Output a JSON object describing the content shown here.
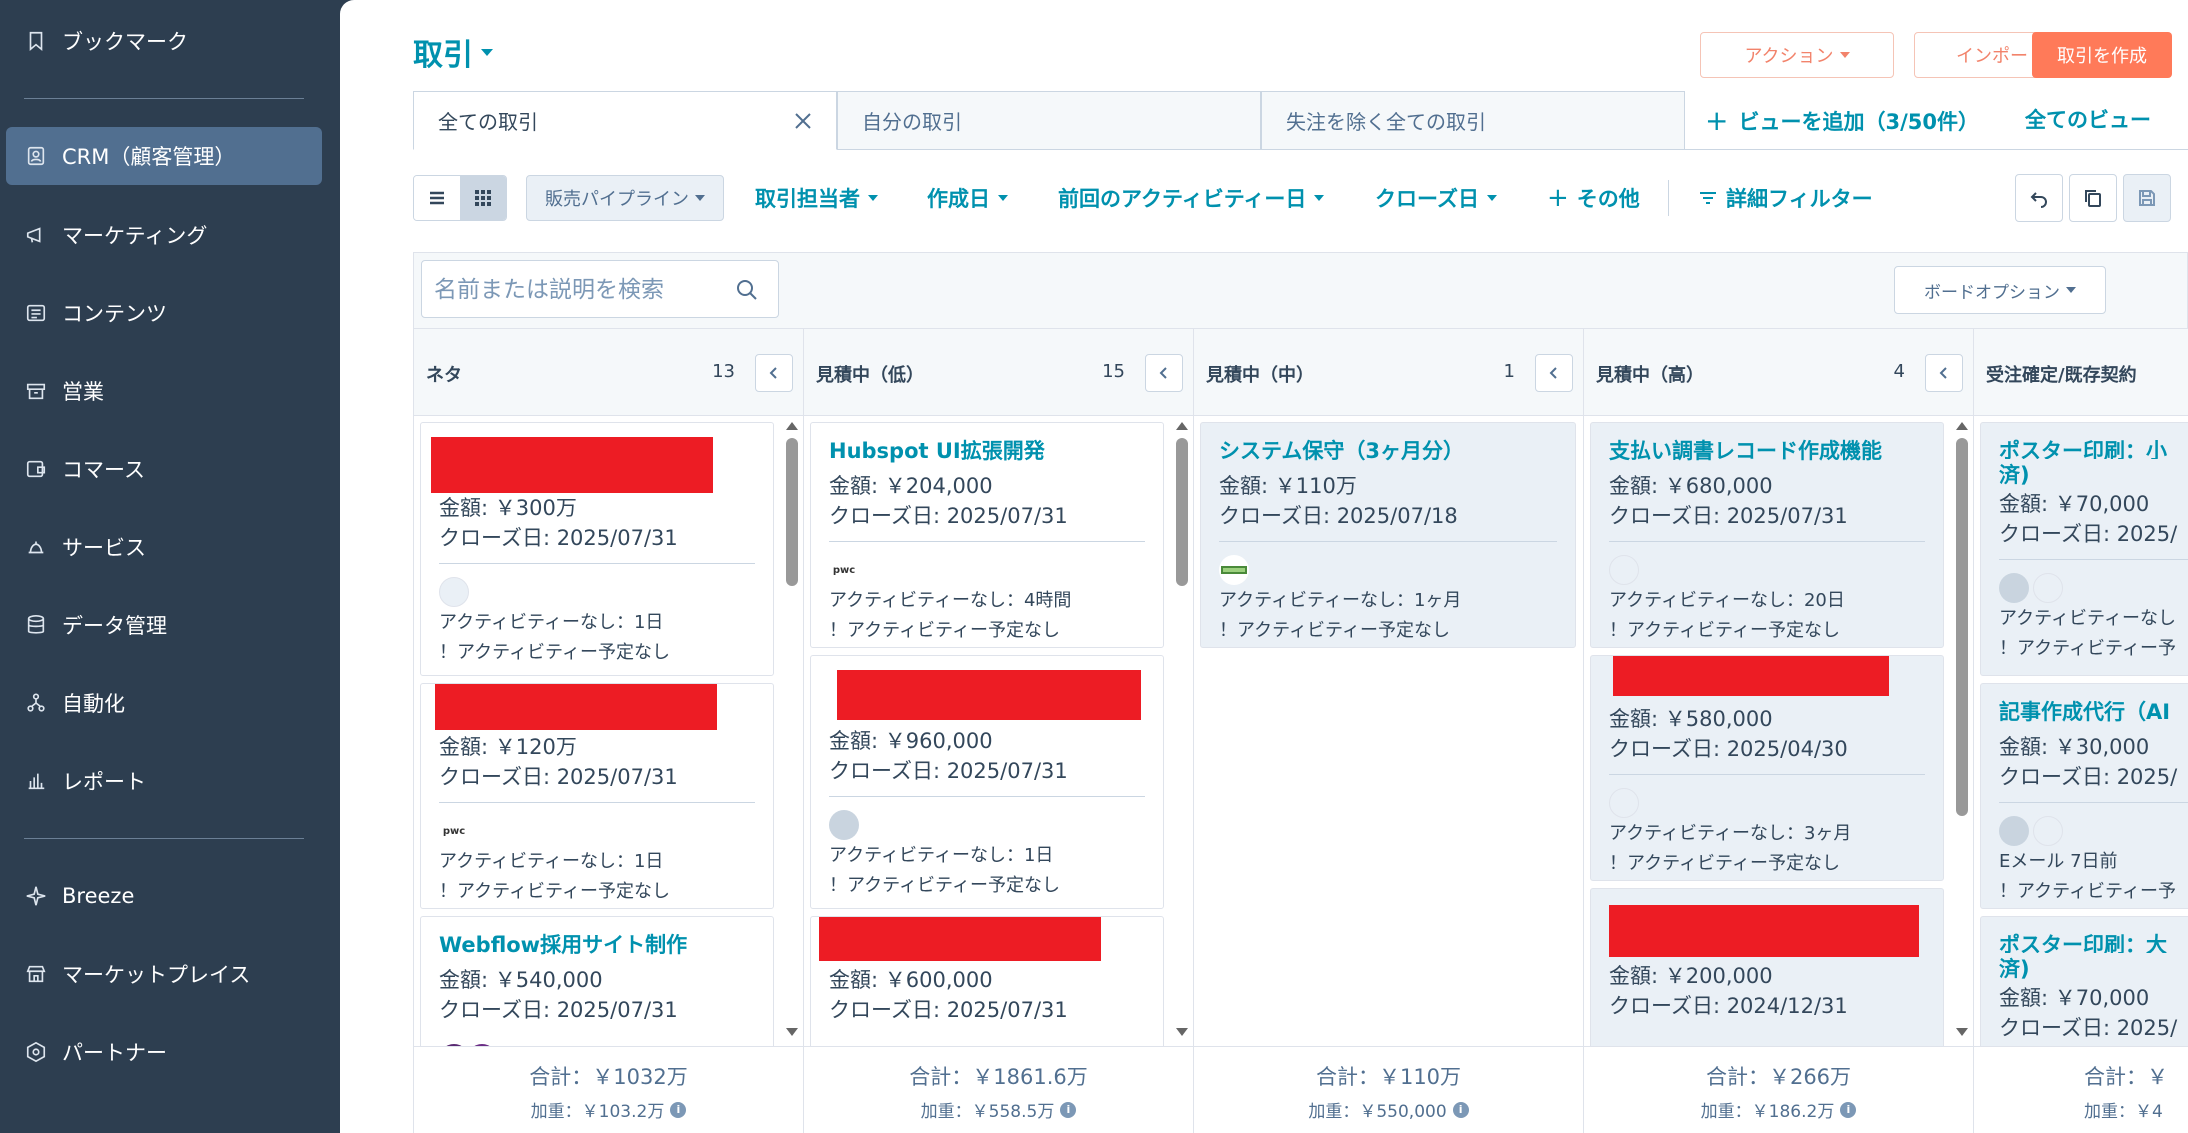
{
  "sidebar": {
    "items": [
      {
        "label": "ブックマーク",
        "icon": "bookmark-icon"
      },
      {
        "label": "CRM（顧客管理）",
        "icon": "contacts-icon",
        "active": true
      },
      {
        "label": "マーケティング",
        "icon": "megaphone-icon"
      },
      {
        "label": "コンテンツ",
        "icon": "content-icon"
      },
      {
        "label": "営業",
        "icon": "sales-icon"
      },
      {
        "label": "コマース",
        "icon": "commerce-icon"
      },
      {
        "label": "サービス",
        "icon": "service-icon"
      },
      {
        "label": "データ管理",
        "icon": "database-icon"
      },
      {
        "label": "自動化",
        "icon": "automation-icon"
      },
      {
        "label": "レポート",
        "icon": "reports-icon"
      },
      {
        "label": "Breeze",
        "icon": "sparkle-icon"
      },
      {
        "label": "マーケットプレイス",
        "icon": "store-icon"
      },
      {
        "label": "パートナー",
        "icon": "partner-icon"
      }
    ]
  },
  "header": {
    "title": "取引",
    "actions_label": "アクション",
    "import_label": "インポート",
    "create_label": "取引を作成"
  },
  "tabs": [
    {
      "label": "全ての取引",
      "active": true
    },
    {
      "label": "自分の取引"
    },
    {
      "label": "失注を除く全ての取引"
    }
  ],
  "add_view_label": "ビューを追加（3/50件）",
  "all_views_label": "全てのビュー",
  "filters": {
    "pipeline": "販売パイプライン",
    "owner": "取引担当者",
    "created": "作成日",
    "last_activity": "前回のアクティビティー日",
    "close_date": "クローズ日",
    "more": "その他",
    "advanced": "詳細フィルター"
  },
  "board": {
    "search_placeholder": "名前または説明を検索",
    "options_label": "ボードオプション",
    "columns": [
      {
        "name": "ネタ",
        "count": "13",
        "total": "合計：￥1032万",
        "weighted": "加重：￥103.2万",
        "cards": [
          {
            "title": "",
            "amount": "金額: ￥300万",
            "close": "クローズ日: 2025/07/31",
            "activity": "アクティビティーなし：1日",
            "next": "！アクティビティー予定なし"
          },
          {
            "title": "",
            "amount": "金額: ￥120万",
            "close": "クローズ日: 2025/07/31",
            "activity": "アクティビティーなし：1日",
            "next": "！アクティビティー予定なし"
          },
          {
            "title": "Webflow採用サイト制作",
            "amount": "金額: ￥540,000",
            "close": "クローズ日: 2025/07/31",
            "activity": "",
            "next": ""
          }
        ]
      },
      {
        "name": "見積中（低）",
        "count": "15",
        "total": "合計：￥1861.6万",
        "weighted": "加重：￥558.5万",
        "cards": [
          {
            "title": "Hubspot UI拡張開発",
            "amount": "金額: ￥204,000",
            "close": "クローズ日: 2025/07/31",
            "activity": "アクティビティーなし：4時間",
            "next": "！アクティビティー予定なし"
          },
          {
            "title": "",
            "amount": "金額: ￥960,000",
            "close": "クローズ日: 2025/07/31",
            "activity": "アクティビティーなし：1日",
            "next": "！アクティビティー予定なし"
          },
          {
            "title": "",
            "amount": "金額: ￥600,000",
            "close": "クローズ日: 2025/07/31",
            "activity": "",
            "next": ""
          }
        ]
      },
      {
        "name": "見積中（中）",
        "count": "1",
        "total": "合計：￥110万",
        "weighted": "加重：￥550,000",
        "cards": [
          {
            "title": "システム保守（3ヶ月分）",
            "amount": "金額: ￥110万",
            "close": "クローズ日: 2025/07/18",
            "activity": "アクティビティーなし：1ヶ月",
            "next": "！アクティビティー予定なし"
          }
        ]
      },
      {
        "name": "見積中（高）",
        "count": "4",
        "total": "合計：￥266万",
        "weighted": "加重：￥186.2万",
        "cards": [
          {
            "title": "支払い調書レコード作成機能",
            "amount": "金額: ￥680,000",
            "close": "クローズ日: 2025/07/31",
            "activity": "アクティビティーなし：20日",
            "next": "！アクティビティー予定なし"
          },
          {
            "title": "",
            "amount": "金額: ￥580,000",
            "close": "クローズ日: 2025/04/30",
            "activity": "アクティビティーなし：3ヶ月",
            "next": "！アクティビティー予定なし"
          },
          {
            "title": "",
            "amount": "金額: ￥200,000",
            "close": "クローズ日: 2024/12/31",
            "activity": "",
            "next": ""
          }
        ]
      },
      {
        "name": "受注確定/既存契約",
        "count": "",
        "total": "合計：￥",
        "weighted": "加重：￥4",
        "cards": [
          {
            "title": "ポスター印刷：小",
            "title2": "済)",
            "amount": "金額: ￥70,000",
            "close": "クローズ日: 2025/",
            "activity": "アクティビティーなし",
            "next": "！アクティビティー予"
          },
          {
            "title": "記事作成代行（AI",
            "amount": "金額: ￥30,000",
            "close": "クローズ日: 2025/",
            "activity": "Eメール 7日前",
            "next": "！アクティビティー予"
          },
          {
            "title": "ポスター印刷：大",
            "title2": "済)",
            "amount": "金額: ￥70,000",
            "close": "クローズ日: 2025/",
            "activity": "",
            "next": ""
          }
        ]
      }
    ]
  },
  "colors": {
    "accent": "#0091ae",
    "primary_button": "#ff7a59",
    "sidebar": "#2d3e50",
    "redaction": "#ed1c24"
  }
}
